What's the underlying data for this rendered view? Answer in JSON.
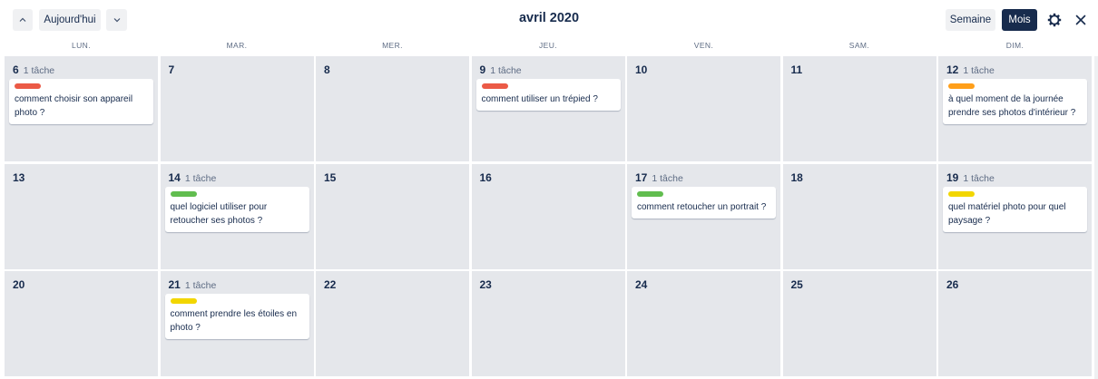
{
  "toolbar": {
    "today_label": "Aujourd'hui",
    "title": "avril 2020",
    "week_label": "Semaine",
    "month_label": "Mois",
    "icons": {
      "prev": "chevron-up-icon",
      "next": "chevron-down-icon",
      "settings": "gear-icon",
      "close": "close-icon"
    }
  },
  "weekdays": [
    "LUN.",
    "MAR.",
    "MER.",
    "JEU.",
    "VEN.",
    "SAM.",
    "DIM."
  ],
  "label_colors": {
    "red": "#eb5a46",
    "orange": "#ff9f1a",
    "green": "#61bd4f",
    "yellow": "#f2d600"
  },
  "weeks": [
    [
      {
        "day": "6",
        "count": "1 tâche",
        "card": {
          "label": "red",
          "text": "comment choisir son appareil photo ?"
        }
      },
      {
        "day": "7"
      },
      {
        "day": "8"
      },
      {
        "day": "9",
        "count": "1 tâche",
        "card": {
          "label": "red",
          "text": "comment utiliser un trépied ?"
        }
      },
      {
        "day": "10"
      },
      {
        "day": "11"
      },
      {
        "day": "12",
        "count": "1 tâche",
        "card": {
          "label": "orange",
          "text": "à quel moment de la journée prendre ses photos d'intérieur ?"
        }
      }
    ],
    [
      {
        "day": "13"
      },
      {
        "day": "14",
        "count": "1 tâche",
        "card": {
          "label": "green",
          "text": "quel logiciel utiliser pour retoucher ses photos ?"
        }
      },
      {
        "day": "15"
      },
      {
        "day": "16"
      },
      {
        "day": "17",
        "count": "1 tâche",
        "card": {
          "label": "green",
          "text": "comment retoucher un portrait ?"
        }
      },
      {
        "day": "18"
      },
      {
        "day": "19",
        "count": "1 tâche",
        "card": {
          "label": "yellow",
          "text": "quel matériel photo pour quel paysage ?"
        }
      }
    ],
    [
      {
        "day": "20"
      },
      {
        "day": "21",
        "count": "1 tâche",
        "card": {
          "label": "yellow",
          "text": "comment prendre les étoiles en photo ?"
        }
      },
      {
        "day": "22"
      },
      {
        "day": "23"
      },
      {
        "day": "24"
      },
      {
        "day": "25"
      },
      {
        "day": "26"
      }
    ]
  ]
}
